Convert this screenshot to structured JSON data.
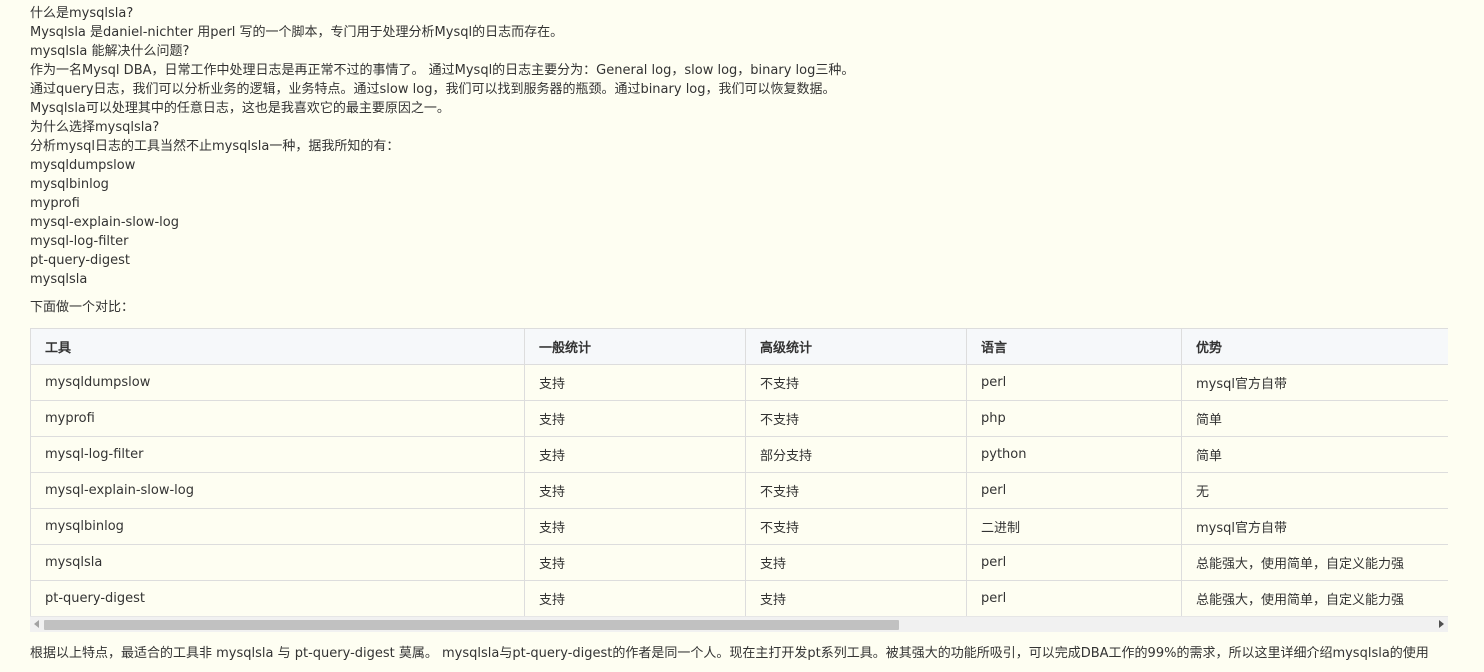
{
  "intro": {
    "q1": "什么是mysqlsla?",
    "p1": "Mysqlsla 是daniel-nichter 用perl 写的一个脚本，专门用于处理分析Mysql的日志而存在。",
    "q2": "mysqlsla 能解决什么问题?",
    "p2": "作为一名Mysql DBA，日常工作中处理日志是再正常不过的事情了。 通过Mysql的日志主要分为：General log，slow log，binary log三种。",
    "p3": "通过query日志，我们可以分析业务的逻辑，业务特点。通过slow log，我们可以找到服务器的瓶颈。通过binary log，我们可以恢复数据。",
    "p4": "Mysqlsla可以处理其中的任意日志，这也是我喜欢它的最主要原因之一。",
    "q3": "为什么选择mysqlsla?",
    "p5": "分析mysql日志的工具当然不止mysqlsla一种，据我所知的有：",
    "tools": [
      "mysqldumpslow",
      "mysqlbinlog",
      "myprofi",
      "mysql-explain-slow-log",
      "mysql-log-filter",
      "pt-query-digest",
      "mysqlsla"
    ],
    "compare_lead": "下面做一个对比："
  },
  "table": {
    "headers": [
      "工具",
      "一般统计",
      "高级统计",
      "语言",
      "优势"
    ],
    "rows": [
      [
        "mysqldumpslow",
        "支持",
        "不支持",
        "perl",
        "mysql官方自带"
      ],
      [
        "myprofi",
        "支持",
        "不支持",
        "php",
        "简单"
      ],
      [
        "mysql-log-filter",
        "支持",
        "部分支持",
        "python",
        "简单"
      ],
      [
        "mysql-explain-slow-log",
        "支持",
        "不支持",
        "perl",
        "无"
      ],
      [
        "mysqlbinlog",
        "支持",
        "不支持",
        "二进制",
        "mysql官方自带"
      ],
      [
        "mysqlsla",
        "支持",
        "支持",
        "perl",
        "总能强大，使用简单，自定义能力强"
      ],
      [
        "pt-query-digest",
        "支持",
        "支持",
        "perl",
        "总能强大，使用简单，自定义能力强"
      ]
    ]
  },
  "footer": "根据以上特点，最适合的工具非 mysqlsla 与 pt-query-digest 莫属。 mysqlsla与pt-query-digest的作者是同一个人。现在主打开发pt系列工具。被其强大的功能所吸引，可以完成DBA工作的99%的需求，所以这里详细介绍mysqlsla的使用"
}
